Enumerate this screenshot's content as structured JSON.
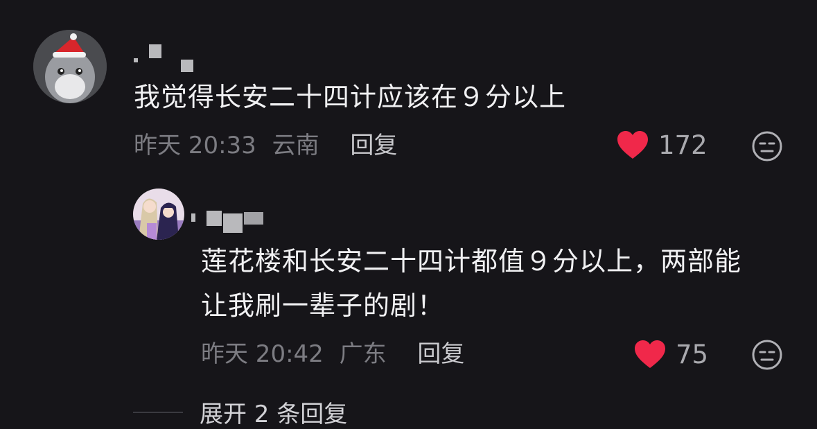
{
  "comments": [
    {
      "text": "我觉得长安二十四计应该在９分以上",
      "time": "昨天 20:33",
      "location": "云南",
      "reply_label": "回复",
      "likes": "172",
      "like_icon": "heart-icon",
      "dislike_icon": "meh-face-icon",
      "avatar_icon": "totoro-avatar"
    },
    {
      "text_lines": [
        "莲花楼和长安二十四计都值９分以上，两部能",
        "让我刷一辈子的剧！"
      ],
      "time": "昨天 20:42",
      "location": "广东",
      "reply_label": "回复",
      "likes": "75",
      "like_icon": "heart-icon",
      "dislike_icon": "meh-face-icon",
      "avatar_icon": "anime-avatar"
    }
  ],
  "expand_label": "展开 2 条回复",
  "colors": {
    "background": "#161519",
    "heart": "#f0284a",
    "text": "#f1f1f3",
    "meta": "#7c7c82"
  }
}
